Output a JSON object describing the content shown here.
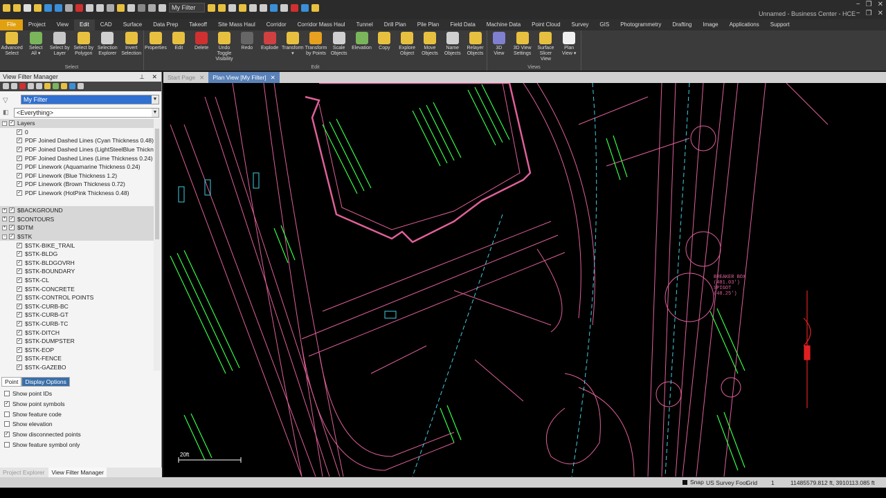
{
  "window": {
    "title": "Unnamed - Business Center - HCE",
    "quick_access_filter": "My Filter"
  },
  "ribbon": {
    "tabs": [
      {
        "label": "File",
        "style": "file"
      },
      {
        "label": "Project"
      },
      {
        "label": "View"
      },
      {
        "label": "Edit",
        "active": true
      },
      {
        "label": "CAD"
      },
      {
        "label": "Surface"
      },
      {
        "label": "Data Prep"
      },
      {
        "label": "Takeoff"
      },
      {
        "label": "Site Mass Haul"
      },
      {
        "label": "Corridor"
      },
      {
        "label": "Corridor Mass Haul"
      },
      {
        "label": "Tunnel"
      },
      {
        "label": "Drill Plan"
      },
      {
        "label": "Pile Plan"
      },
      {
        "label": "Field Data"
      },
      {
        "label": "Machine Data"
      },
      {
        "label": "Point Cloud"
      },
      {
        "label": "Survey"
      },
      {
        "label": "GIS"
      },
      {
        "label": "Photogrammetry"
      },
      {
        "label": "Drafting"
      },
      {
        "label": "Image"
      },
      {
        "label": "Applications"
      },
      {
        "label": "Support"
      }
    ],
    "groups": [
      {
        "title": "Select",
        "width": 208,
        "buttons": [
          {
            "label": "Advanced\nSelect",
            "icon": "advanced-select-icon",
            "color": "#e8c040"
          },
          {
            "label": "Select\nAll ▾",
            "icon": "select-all-icon",
            "color": "#7ab55c"
          },
          {
            "label": "Select by\nLayer",
            "icon": "select-by-layer-icon",
            "color": "#c8c8c8"
          },
          {
            "label": "Select by\nPolygon",
            "icon": "select-by-polygon-icon",
            "color": "#e8c040"
          },
          {
            "label": "Selection\nExplorer",
            "icon": "selection-explorer-icon",
            "color": "#d0d0d0"
          },
          {
            "label": "Invert\nSelection",
            "icon": "invert-selection-icon",
            "color": "#e8c040"
          }
        ]
      },
      {
        "title": "Edit",
        "width": 496,
        "buttons": [
          {
            "label": "Properties",
            "icon": "properties-icon",
            "color": "#e8c040"
          },
          {
            "label": "Edit",
            "icon": "pencil-icon",
            "color": "#e8c040"
          },
          {
            "label": "Delete",
            "icon": "delete-x-icon",
            "color": "#d03030"
          },
          {
            "label": "Undo Toggle\nVisibility",
            "icon": "undo-toggle-icon",
            "color": "#e8c040"
          },
          {
            "label": "Redo",
            "icon": "redo-icon",
            "color": "#666666"
          },
          {
            "label": "Explode",
            "icon": "explode-icon",
            "color": "#d04040"
          },
          {
            "label": "Transform\n▾",
            "icon": "transform-icon",
            "color": "#e8c040"
          },
          {
            "label": "Transform\nby Points",
            "icon": "transform-by-points-icon",
            "color": "#e8a020"
          },
          {
            "label": "Scale\nObjects",
            "icon": "scale-objects-icon",
            "color": "#d0d0d0"
          },
          {
            "label": "Elevation",
            "icon": "elevation-icon",
            "color": "#7ab55c"
          },
          {
            "label": "Copy",
            "icon": "copy-icon",
            "color": "#e8c040"
          },
          {
            "label": "Explore\nObject",
            "icon": "explore-object-icon",
            "color": "#e8c040"
          },
          {
            "label": "Move\nObjects",
            "icon": "move-objects-icon",
            "color": "#e8c040"
          },
          {
            "label": "Name\nObjects",
            "icon": "name-objects-icon",
            "color": "#d0d0d0"
          },
          {
            "label": "Relayer\nObjects",
            "icon": "relayer-objects-icon",
            "color": "#e8c040"
          }
        ]
      },
      {
        "title": "Views",
        "width": 136,
        "buttons": [
          {
            "label": "3D\nView",
            "icon": "3d-view-icon",
            "color": "#8080d0"
          },
          {
            "label": "3D View\nSettings",
            "icon": "3d-view-settings-icon",
            "color": "#e8c040"
          },
          {
            "label": "Surface\nSlicer View",
            "icon": "surface-slicer-icon",
            "color": "#e8c040"
          },
          {
            "label": "Plan\nView ▾",
            "icon": "plan-view-icon",
            "color": "#f0f0f0"
          }
        ]
      }
    ]
  },
  "view_filter_manager": {
    "title": "View Filter Manager",
    "filter": "My Filter",
    "scope": "<Everything>",
    "tree": [
      {
        "label": "Layers",
        "level": 0,
        "group": true,
        "checked": true,
        "expand": "−"
      },
      {
        "label": "0",
        "level": 1,
        "checked": true
      },
      {
        "label": "PDF Joined Dashed Lines (Cyan Thickness 0.48)",
        "level": 1,
        "checked": true
      },
      {
        "label": "PDF Joined Dashed Lines (LightSteelBlue Thickness",
        "level": 1,
        "checked": true
      },
      {
        "label": "PDF Joined Dashed Lines (Lime Thickness 0.24)",
        "level": 1,
        "checked": true
      },
      {
        "label": "PDF Linework (Aquamarine Thickness 0.24)",
        "level": 1,
        "checked": true
      },
      {
        "label": "PDF Linework (Blue Thickness 1.2)",
        "level": 1,
        "checked": true
      },
      {
        "label": "PDF Linework (Brown Thickness 0.72)",
        "level": 1,
        "checked": true
      },
      {
        "label": "PDF Linework (HotPink Thickness 0.48)",
        "level": 1,
        "checked": true
      },
      {
        "label": "",
        "level": 1,
        "spacer": true
      },
      {
        "label": "$BACKGROUND",
        "level": 0,
        "group": true,
        "checked": true,
        "expand": "+"
      },
      {
        "label": "$CONTOURS",
        "level": 0,
        "group": true,
        "checked": true,
        "expand": "+"
      },
      {
        "label": "$DTM",
        "level": 0,
        "group": true,
        "checked": true,
        "expand": "+"
      },
      {
        "label": "$STK",
        "level": 0,
        "group": true,
        "checked": true,
        "expand": "−"
      },
      {
        "label": "$STK-BIKE_TRAIL",
        "level": 1,
        "checked": true
      },
      {
        "label": "$STK-BLDG",
        "level": 1,
        "checked": true
      },
      {
        "label": "$STK-BLDGOVRH",
        "level": 1,
        "checked": true
      },
      {
        "label": "$STK-BOUNDARY",
        "level": 1,
        "checked": true
      },
      {
        "label": "$STK-CL",
        "level": 1,
        "checked": true
      },
      {
        "label": "$STK-CONCRETE",
        "level": 1,
        "checked": true
      },
      {
        "label": "$STK-CONTROL POINTS",
        "level": 1,
        "checked": true
      },
      {
        "label": "$STK-CURB-BC",
        "level": 1,
        "checked": true
      },
      {
        "label": "$STK-CURB-GT",
        "level": 1,
        "checked": true
      },
      {
        "label": "$STK-CURB-TC",
        "level": 1,
        "checked": true
      },
      {
        "label": "$STK-DITCH",
        "level": 1,
        "checked": true
      },
      {
        "label": "$STK-DUMPSTER",
        "level": 1,
        "checked": true
      },
      {
        "label": "$STK-EOP",
        "level": 1,
        "checked": true
      },
      {
        "label": "$STK-FENCE",
        "level": 1,
        "checked": true
      },
      {
        "label": "$STK-GAZEBO",
        "level": 1,
        "checked": true
      }
    ],
    "option_tabs": [
      "Point",
      "Display Options"
    ],
    "options": [
      {
        "label": "Show point IDs",
        "checked": false
      },
      {
        "label": "Show point symbols",
        "checked": true
      },
      {
        "label": "Show feature code",
        "checked": false
      },
      {
        "label": "Show elevation",
        "checked": false
      },
      {
        "label": "Show disconnected points",
        "checked": true
      },
      {
        "label": "Show feature symbol only",
        "checked": false
      }
    ],
    "bottom_tabs": [
      "Project Explorer",
      "View Filter Manager"
    ]
  },
  "doc_tabs": [
    "Start Page",
    "Plan View [My Filter]"
  ],
  "plan": {
    "annotations": [
      "BREAKER BOX",
      "(481.03')",
      "SPIGOT",
      "(48.25')"
    ],
    "scale_label": "20ft",
    "colors": {
      "pink": "#e0609a",
      "green": "#33ff44",
      "cyan": "#40d0e0",
      "red": "#e02020"
    }
  },
  "status": {
    "snap": "Snap",
    "units": "US Survey Foot",
    "grid_label": "Grid",
    "grid_value": "1",
    "coords": "11485579.812 ft, 3910113.085 ft"
  }
}
